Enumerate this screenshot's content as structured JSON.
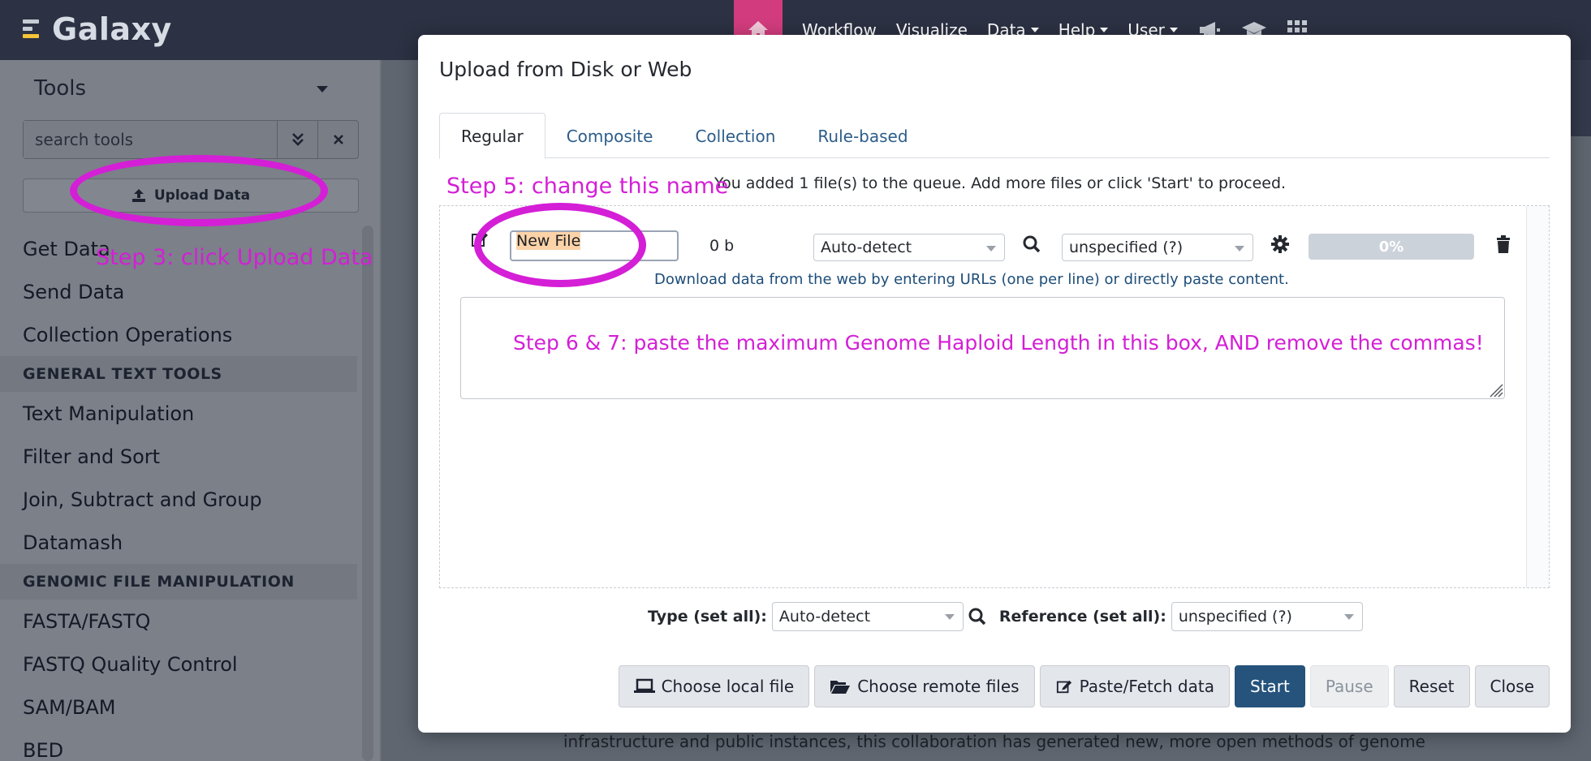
{
  "brand": {
    "name": "Galaxy"
  },
  "nav": {
    "items": [
      {
        "label": "Workflow"
      },
      {
        "label": "Visualize"
      },
      {
        "label": "Data"
      },
      {
        "label": "Help"
      },
      {
        "label": "User"
      }
    ],
    "active_color": "#d23c7e"
  },
  "tool_panel": {
    "header": "Tools",
    "search_placeholder": "search tools",
    "upload_label": "Upload Data",
    "items": [
      {
        "kind": "tool",
        "label": "Get Data"
      },
      {
        "kind": "tool",
        "label": "Send Data"
      },
      {
        "kind": "tool",
        "label": "Collection Operations"
      },
      {
        "kind": "section",
        "label": "GENERAL TEXT TOOLS"
      },
      {
        "kind": "tool",
        "label": "Text Manipulation"
      },
      {
        "kind": "tool",
        "label": "Filter and Sort"
      },
      {
        "kind": "tool",
        "label": "Join, Subtract and Group"
      },
      {
        "kind": "tool",
        "label": "Datamash"
      },
      {
        "kind": "section",
        "label": "GENOMIC FILE MANIPULATION"
      },
      {
        "kind": "tool",
        "label": "FASTA/FASTQ"
      },
      {
        "kind": "tool",
        "label": "FASTQ Quality Control"
      },
      {
        "kind": "tool",
        "label": "SAM/BAM"
      },
      {
        "kind": "tool",
        "label": "BED"
      }
    ]
  },
  "background": {
    "text": "infrastructure and public instances, this collaboration has generated new, more open methods of genome"
  },
  "modal": {
    "title": "Upload from Disk or Web",
    "tabs": [
      {
        "label": "Regular",
        "active": true
      },
      {
        "label": "Composite",
        "active": false
      },
      {
        "label": "Collection",
        "active": false
      },
      {
        "label": "Rule-based",
        "active": false
      }
    ],
    "queue_message": "You added 1 file(s) to the queue. Add more files or click 'Start' to proceed.",
    "upload_row": {
      "name": "New File",
      "size": "0 b",
      "type": "Auto-detect",
      "reference": "unspecified (?)",
      "progress": "0%",
      "progress_fraction": 0,
      "paste_hint": "Download data from the web by entering URLs (one per line) or directly paste content.",
      "paste_content": ""
    },
    "set_all": {
      "type_label": "Type (set all):",
      "type_value": "Auto-detect",
      "reference_label": "Reference (set all):",
      "reference_value": "unspecified (?)"
    },
    "buttons": {
      "choose_local": "Choose local file",
      "choose_remote": "Choose remote files",
      "paste_fetch": "Paste/Fetch data",
      "start": "Start",
      "pause": "Pause",
      "reset": "Reset",
      "close": "Close"
    },
    "primary_color": "#25537b"
  },
  "annotations": {
    "color": "#d41fd6",
    "step3": "Step 3: click Upload Data",
    "step5": "Step 5: change this name",
    "step67": "Step 6 & 7: paste the maximum Genome Haploid Length in this box, AND remove the commas!"
  }
}
